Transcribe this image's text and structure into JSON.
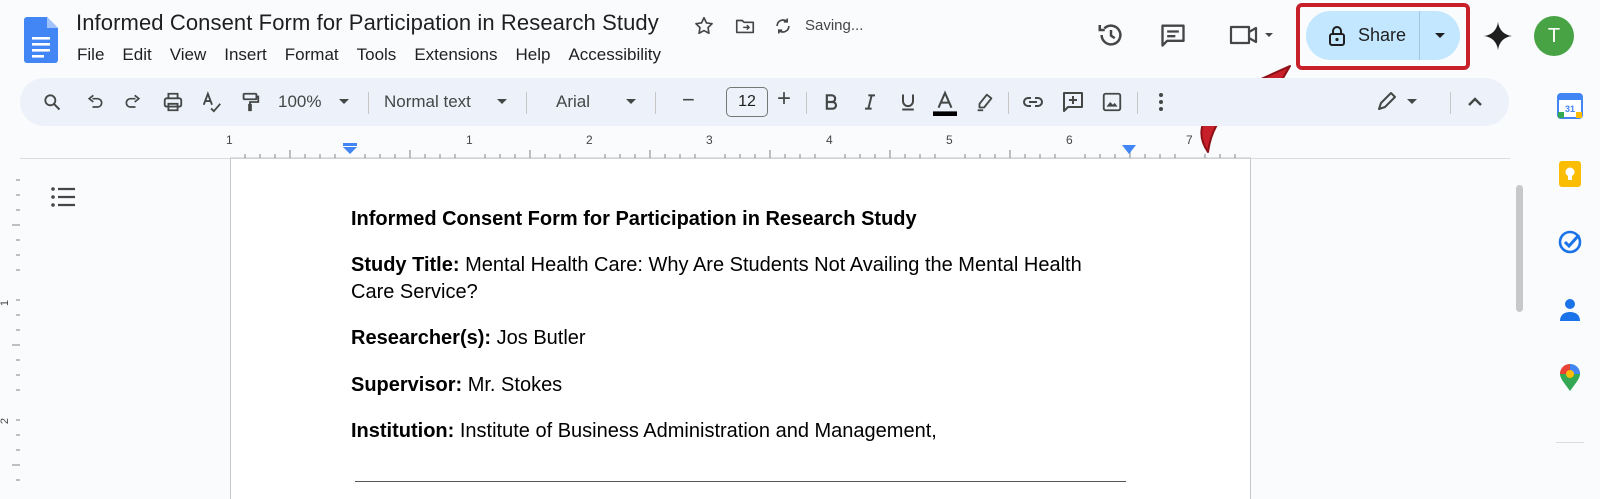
{
  "header": {
    "doc_title": "Informed Consent Form for Participation in Research Study",
    "saving_status": "Saving...",
    "avatar_initial": "T",
    "share_label": "Share"
  },
  "menu": [
    "File",
    "Edit",
    "View",
    "Insert",
    "Format",
    "Tools",
    "Extensions",
    "Help",
    "Accessibility"
  ],
  "toolbar": {
    "zoom": "100%",
    "style": "Normal text",
    "font": "Arial",
    "font_size": "12",
    "minus": "−",
    "plus": "+"
  },
  "ruler": {
    "labels": [
      "1",
      "1",
      "2",
      "3",
      "4",
      "5",
      "6",
      "7"
    ],
    "left_labels": [
      "1",
      "2"
    ]
  },
  "document": {
    "heading": "Informed Consent Form for Participation in Research Study",
    "study_title_label": "Study Title:",
    "study_title_value": " Mental Health Care: Why Are Students Not Availing the Mental Health Care Service?",
    "researcher_label": "Researcher(s):",
    "researcher_value": " Jos Butler",
    "supervisor_label": "Supervisor:",
    "supervisor_value": " Mr. Stokes",
    "institution_label": "Institution:",
    "institution_value": " Institute of Business Administration and Management,"
  },
  "colors": {
    "accent_blue": "#0b57d0",
    "share_bg": "#c2e7ff",
    "highlight_red": "#c8202a",
    "avatar_green": "#47a344",
    "docs_blue": "#4285f4"
  },
  "icons": [
    "docs-logo-icon",
    "star-icon",
    "move-folder-icon",
    "sync-icon",
    "history-icon",
    "comment-icon",
    "meet-icon",
    "lock-icon",
    "gemini-icon",
    "search-icon",
    "undo-icon",
    "redo-icon",
    "print-icon",
    "spellcheck-icon",
    "paint-format-icon",
    "bold-icon",
    "italic-icon",
    "underline-icon",
    "text-color-icon",
    "highlight-icon",
    "link-icon",
    "add-comment-icon",
    "image-icon",
    "more-icon",
    "edit-mode-icon",
    "collapse-icon",
    "outline-icon",
    "calendar-icon",
    "keep-icon",
    "tasks-icon",
    "contacts-icon",
    "maps-icon"
  ]
}
